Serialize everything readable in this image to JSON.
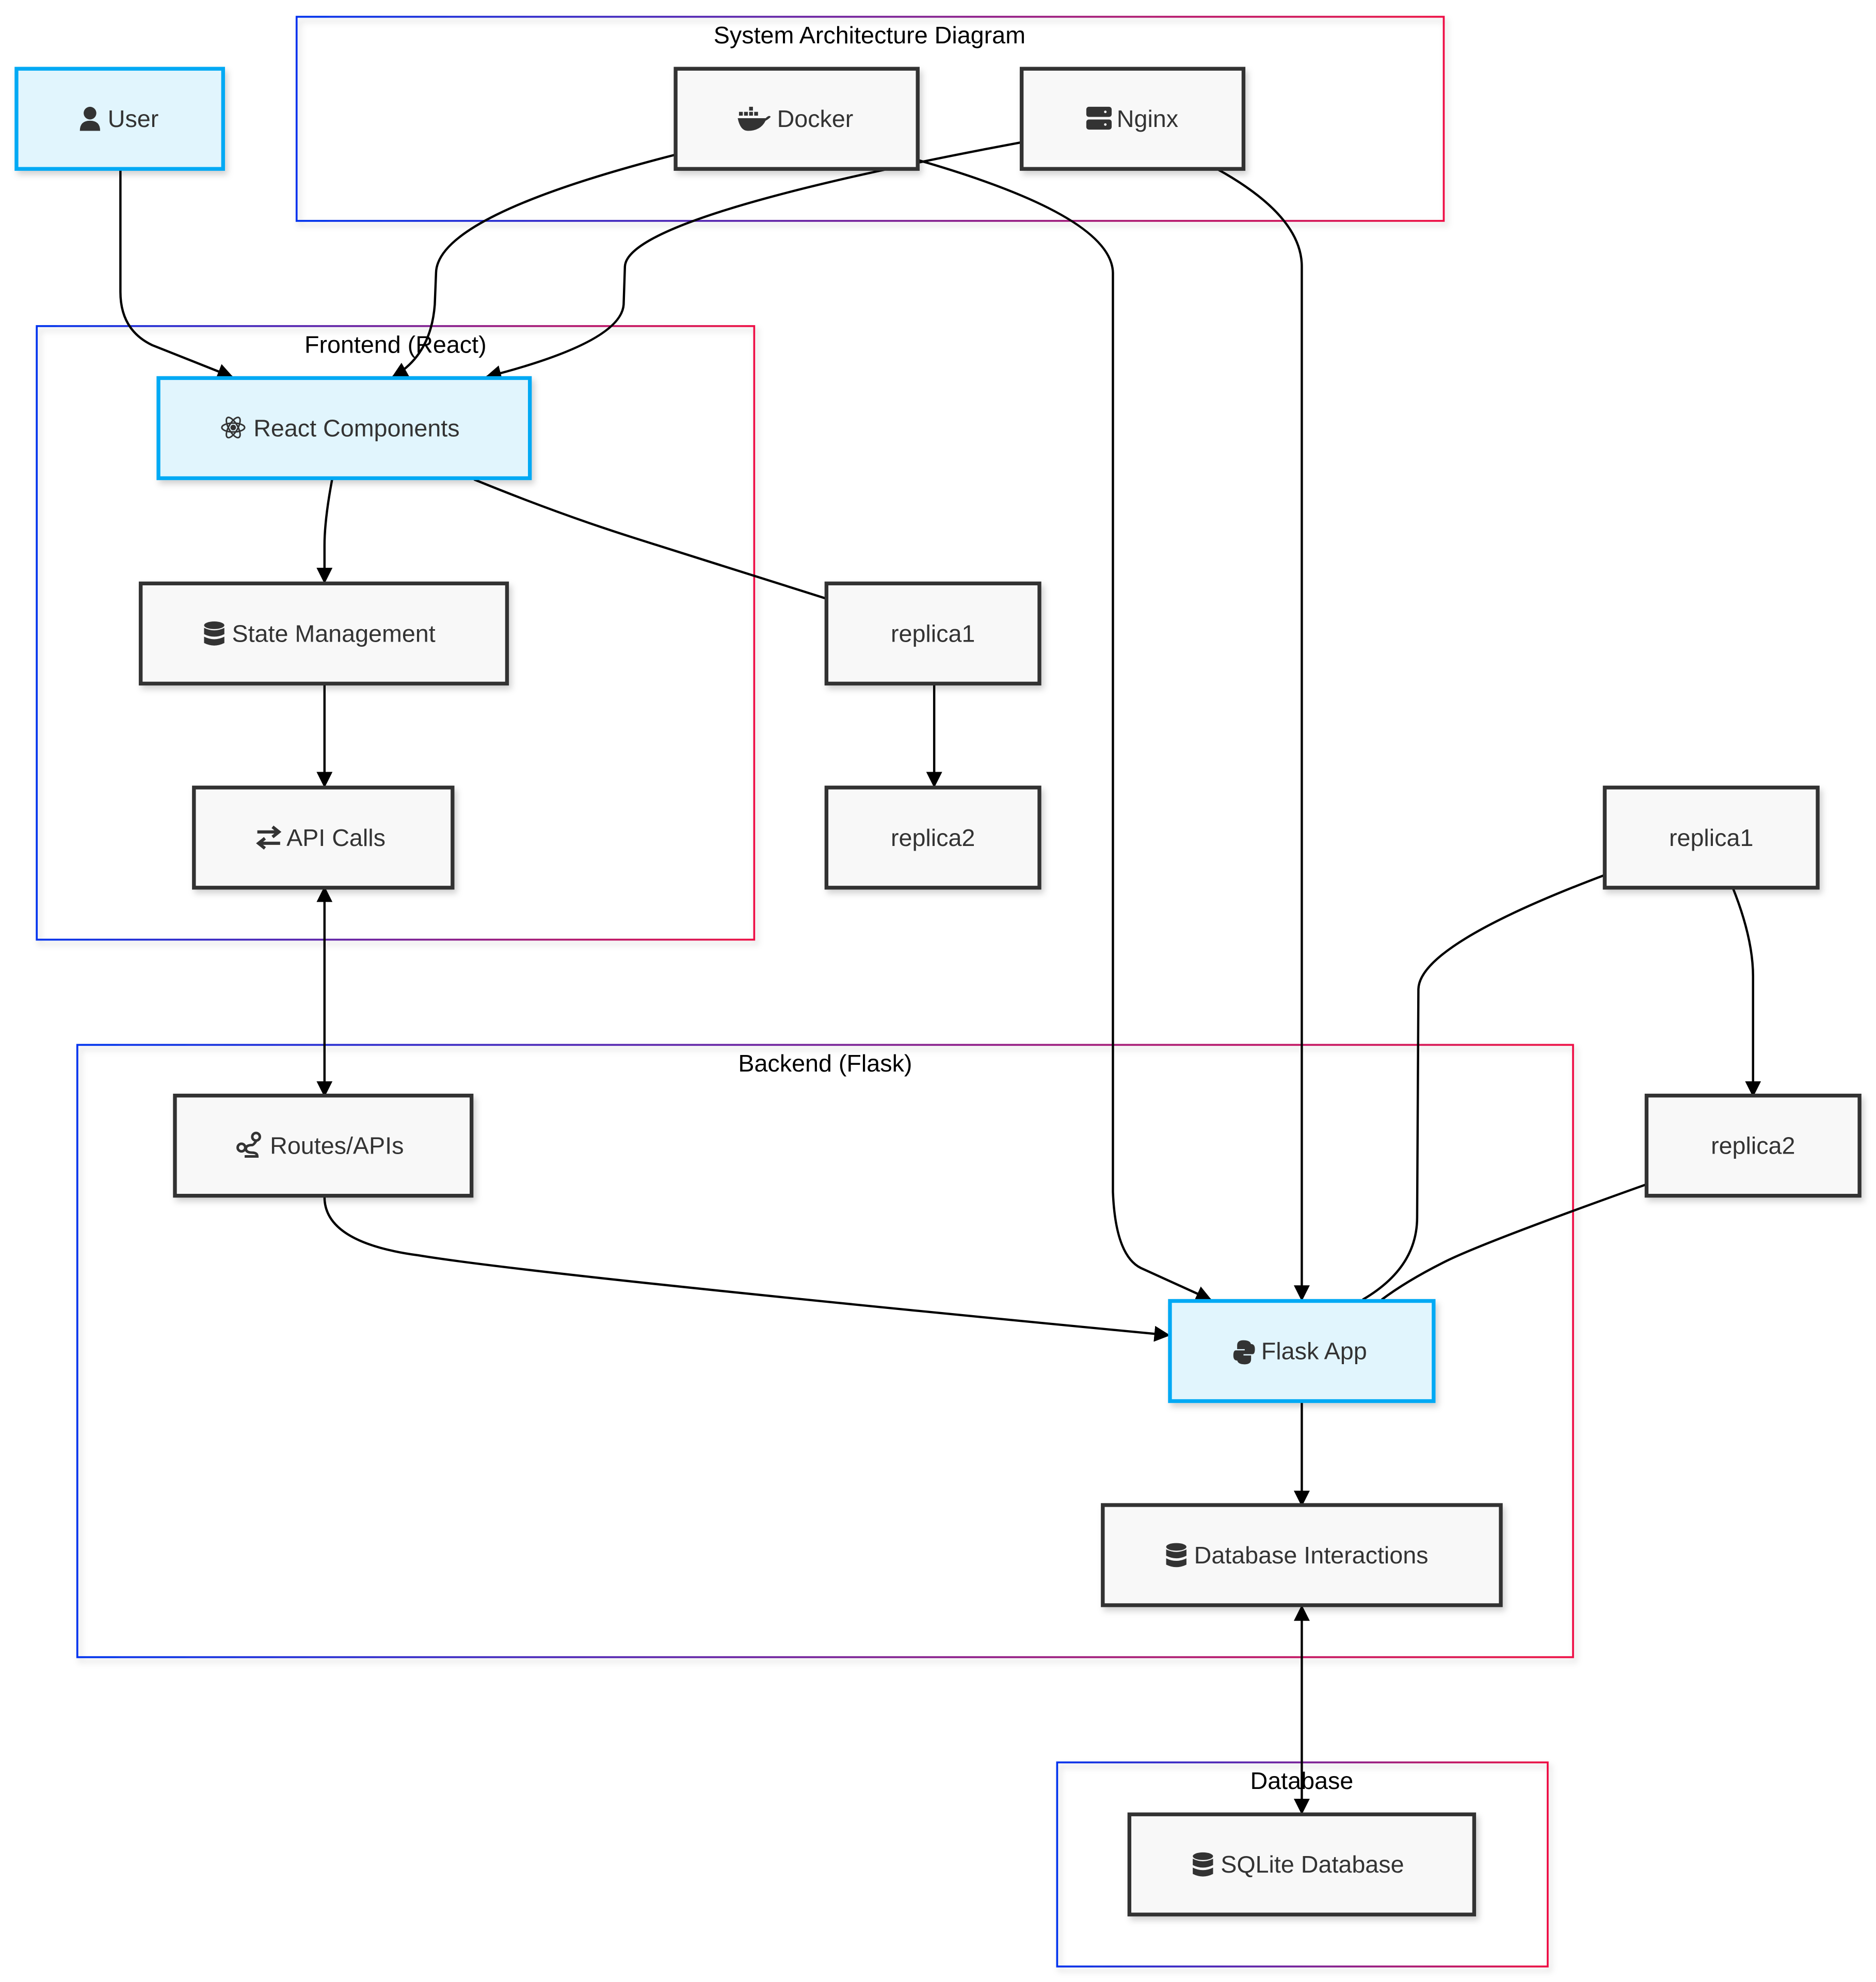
{
  "title": "System Architecture Diagram",
  "clusters": [
    {
      "id": "sys",
      "label": "System Architecture Diagram"
    },
    {
      "id": "frontend",
      "label": "Frontend (React)"
    },
    {
      "id": "backend",
      "label": "Backend (Flask)"
    },
    {
      "id": "database",
      "label": "Database"
    }
  ],
  "nodes": {
    "user": {
      "label": "User",
      "icon": "user-icon",
      "highlighted": true
    },
    "docker": {
      "label": "Docker",
      "icon": "docker-icon",
      "highlighted": false
    },
    "nginx": {
      "label": "Nginx",
      "icon": "server-icon",
      "highlighted": false
    },
    "react": {
      "label": "React Components",
      "icon": "react-icon",
      "highlighted": true
    },
    "state": {
      "label": "State Management",
      "icon": "database-icon",
      "highlighted": false
    },
    "api": {
      "label": "API Calls",
      "icon": "exchange-arrows-icon",
      "highlighted": false
    },
    "replica1a": {
      "label": "replica1",
      "icon": "",
      "highlighted": false
    },
    "replica2a": {
      "label": "replica2",
      "icon": "",
      "highlighted": false
    },
    "replica1b": {
      "label": "replica1",
      "icon": "",
      "highlighted": false
    },
    "replica2b": {
      "label": "replica2",
      "icon": "",
      "highlighted": false
    },
    "routes": {
      "label": "Routes/APIs",
      "icon": "route-icon",
      "highlighted": false
    },
    "flask": {
      "label": "Flask App",
      "icon": "python-icon",
      "highlighted": true
    },
    "dbi": {
      "label": "Database Interactions",
      "icon": "database-icon",
      "highlighted": false
    },
    "sqlite": {
      "label": "SQLite Database",
      "icon": "database-icon",
      "highlighted": false
    }
  },
  "edges": [
    {
      "from": "User",
      "to": "React Components",
      "type": "arrow"
    },
    {
      "from": "Docker",
      "to": "React Components",
      "type": "arrow"
    },
    {
      "from": "Nginx",
      "to": "React Components",
      "type": "arrow"
    },
    {
      "from": "Docker",
      "to": "Flask App",
      "type": "arrow"
    },
    {
      "from": "Nginx",
      "to": "Flask App",
      "type": "arrow"
    },
    {
      "from": "React Components",
      "to": "State Management",
      "type": "arrow"
    },
    {
      "from": "State Management",
      "to": "API Calls",
      "type": "arrow"
    },
    {
      "from": "React Components",
      "to": "replica1",
      "type": "line"
    },
    {
      "from": "replica1",
      "to": "replica2",
      "type": "arrow"
    },
    {
      "from": "API Calls",
      "to": "Routes/APIs",
      "type": "bidirectional"
    },
    {
      "from": "Routes/APIs",
      "to": "Flask App",
      "type": "arrow"
    },
    {
      "from": "replica1",
      "to": "Flask App",
      "type": "line"
    },
    {
      "from": "replica1",
      "to": "replica2",
      "type": "arrow"
    },
    {
      "from": "replica2",
      "to": "Flask App",
      "type": "line"
    },
    {
      "from": "Flask App",
      "to": "Database Interactions",
      "type": "arrow"
    },
    {
      "from": "Database Interactions",
      "to": "SQLite Database",
      "type": "bidirectional"
    }
  ],
  "colors": {
    "highlight_fill": "#e1f5fd",
    "highlight_stroke": "#03a9f4",
    "node_fill": "#f8f8f8",
    "node_stroke": "#333333",
    "cluster_gradient_start": "#0033ee",
    "cluster_gradient_end": "#ee1144"
  }
}
